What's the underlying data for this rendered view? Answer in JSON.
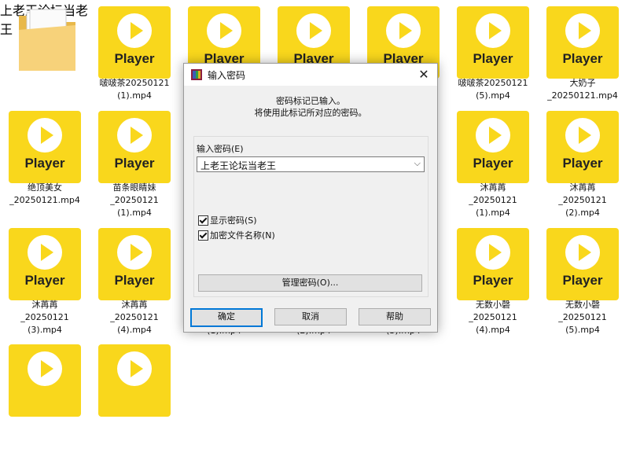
{
  "colors": {
    "player_yellow": "#f9d71c",
    "accent": "#0078d7"
  },
  "files": [
    {
      "kind": "folder",
      "name": "上老王论坛当老\n王"
    },
    {
      "kind": "video",
      "name": "啵啵茶20250121\n(1).mp4",
      "thumb": "Player"
    },
    {
      "kind": "video",
      "name": "",
      "thumb": "Player"
    },
    {
      "kind": "video",
      "name": "",
      "thumb": "Player"
    },
    {
      "kind": "video",
      "name": "",
      "thumb": "Player"
    },
    {
      "kind": "video",
      "name": "啵啵茶20250121\n(5).mp4",
      "thumb": "Player"
    },
    {
      "kind": "video",
      "name": "大奶子\n_20250121.mp4",
      "thumb": "Player"
    },
    {
      "kind": "video",
      "name": "绝顶美女\n_20250121.mp4",
      "thumb": "Player"
    },
    {
      "kind": "video",
      "name": "苗条眼睛妹\n_20250121\n(1).mp4",
      "thumb": "Player"
    },
    {
      "kind": "video",
      "name": "沐苒苒\n_20250121\n(1).mp4",
      "thumb": "Player"
    },
    {
      "kind": "video",
      "name": "沐苒苒\n_20250121\n(2).mp4",
      "thumb": "Player"
    },
    {
      "kind": "video",
      "name": "沐苒苒\n_20250121\n(3).mp4",
      "thumb": "Player"
    },
    {
      "kind": "video",
      "name": "沐苒苒\n_20250121\n(4).mp4",
      "thumb": "Player"
    },
    {
      "kind": "video",
      "name": "(1).mp4",
      "thumb": ""
    },
    {
      "kind": "video",
      "name": "(2).mp4",
      "thumb": ""
    },
    {
      "kind": "video",
      "name": "(3).mp4",
      "thumb": ""
    },
    {
      "kind": "video",
      "name": "无数小磬\n_20250121\n(4).mp4",
      "thumb": "Player"
    },
    {
      "kind": "video",
      "name": "无数小磬\n_20250121\n(5).mp4",
      "thumb": "Player"
    }
  ],
  "dialog": {
    "title": "输入密码",
    "info": "密码标记已输入。\n将使用此标记所对应的密码。",
    "password_label": "输入密码(E)",
    "password_value": "上老王论坛当老王",
    "show_password_label": "显示密码(S)",
    "encrypt_names_label": "加密文件名称(N)",
    "manage_label": "管理密码(O)...",
    "ok_label": "确定",
    "cancel_label": "取消",
    "help_label": "帮助",
    "close_glyph": "✕",
    "dropdown_glyph": "⌵"
  }
}
